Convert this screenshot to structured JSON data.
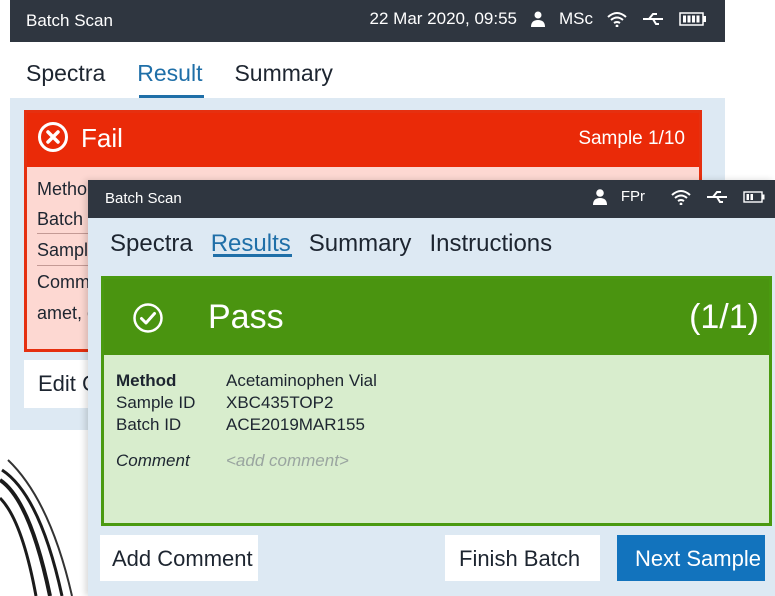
{
  "back_screen": {
    "status_bar": {
      "title": "Batch Scan",
      "datetime": "22 Mar 2020, 09:55",
      "user": "MSc"
    },
    "tabs": [
      "Spectra",
      "Result",
      "Summary"
    ],
    "active_tab": "Result",
    "result": {
      "status": "Fail",
      "sample_counter": "Sample 1/10",
      "partial_lines": [
        "Metho",
        "Batch I",
        "Sampl",
        "Comm",
        "amet, c"
      ]
    },
    "edit_button_label": "Edit C",
    "colors": {
      "fail_header": "#ea2a08",
      "fail_body": "#fdd8d2"
    }
  },
  "front_screen": {
    "status_bar": {
      "title": "Batch Scan",
      "user": "FPr"
    },
    "tabs": [
      "Spectra",
      "Results",
      "Summary",
      "Instructions"
    ],
    "active_tab": "Results",
    "result": {
      "status": "Pass",
      "counter": "(1/1)",
      "rows": [
        {
          "label": "Method",
          "value": "Acetaminophen Vial"
        },
        {
          "label": "Sample ID",
          "value": "XBC435TOP2"
        },
        {
          "label": "Batch ID",
          "value": "ACE2019MAR155"
        }
      ],
      "comment_label": "Comment",
      "comment_placeholder": "<add comment>"
    },
    "buttons": {
      "add_comment": "Add Comment",
      "finish_batch": "Finish Batch",
      "next_sample": "Next Sample"
    },
    "colors": {
      "pass_header": "#4a9410",
      "pass_body": "#d8edcd",
      "primary_button": "#1273bd"
    }
  },
  "icons": [
    "user-icon",
    "wifi-icon",
    "usb-icon",
    "battery-icon",
    "fail-x-icon",
    "pass-check-icon"
  ]
}
